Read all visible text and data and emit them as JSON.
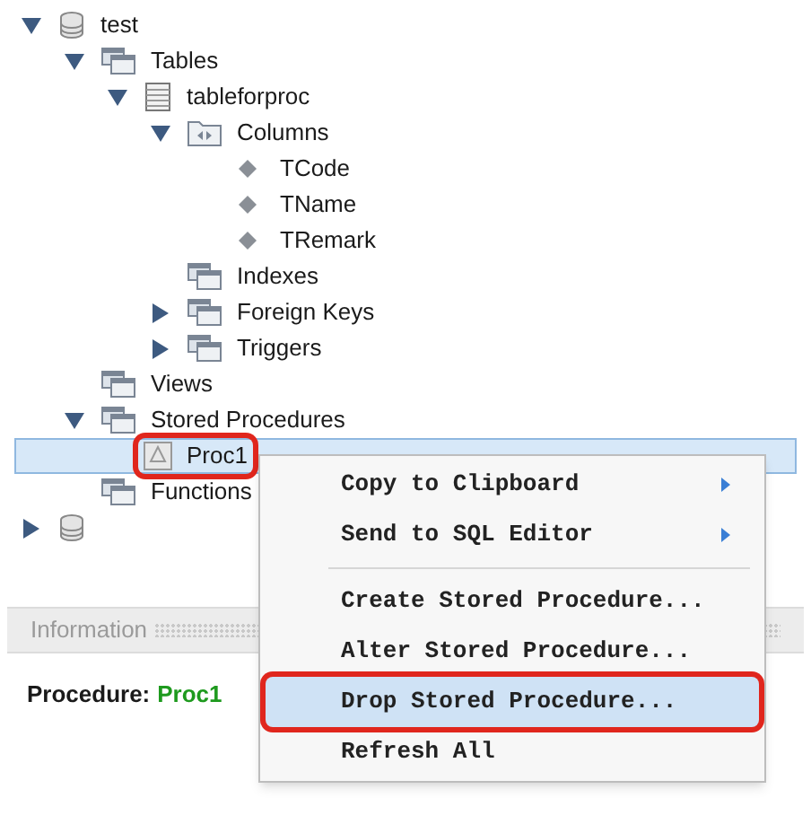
{
  "tree": [
    {
      "label": "test",
      "kind": "database",
      "expanded": true,
      "children": [
        {
          "label": "Tables",
          "kind": "folder",
          "expanded": true,
          "children": [
            {
              "label": "tableforproc",
              "kind": "table",
              "expanded": true,
              "children": [
                {
                  "label": "Columns",
                  "kind": "columns",
                  "expanded": true,
                  "children": [
                    {
                      "label": "TCode",
                      "kind": "column"
                    },
                    {
                      "label": "TName",
                      "kind": "column"
                    },
                    {
                      "label": "TRemark",
                      "kind": "column"
                    }
                  ]
                },
                {
                  "label": "Indexes",
                  "kind": "folder"
                },
                {
                  "label": "Foreign Keys",
                  "kind": "folder",
                  "expanded": false
                },
                {
                  "label": "Triggers",
                  "kind": "folder",
                  "expanded": false
                }
              ]
            }
          ]
        },
        {
          "label": "Views",
          "kind": "folder"
        },
        {
          "label": "Stored Procedures",
          "kind": "folder",
          "expanded": true,
          "children": [
            {
              "label": "Proc1",
              "kind": "procedure",
              "selected": true,
              "marked": true
            }
          ]
        },
        {
          "label": "Functions",
          "kind": "folder"
        }
      ]
    },
    {
      "kind": "database",
      "expanded": false
    }
  ],
  "context_menu": [
    {
      "kind": "item",
      "label": "Copy to Clipboard",
      "submenu": true,
      "selected": false,
      "marked": false
    },
    {
      "kind": "item",
      "label": "Send to SQL Editor",
      "submenu": true,
      "selected": false,
      "marked": false
    },
    {
      "kind": "separator"
    },
    {
      "kind": "item",
      "label": "Create Stored Procedure...",
      "submenu": false,
      "selected": false,
      "marked": false
    },
    {
      "kind": "item",
      "label": "Alter Stored Procedure...",
      "submenu": false,
      "selected": false,
      "marked": false
    },
    {
      "kind": "item",
      "label": "Drop Stored Procedure...",
      "submenu": false,
      "selected": true,
      "marked": true
    },
    {
      "kind": "item",
      "label": "Refresh All",
      "submenu": false,
      "selected": false,
      "marked": false
    }
  ],
  "information": {
    "title": "Information",
    "label": "Procedure:",
    "value": "Proc1"
  }
}
